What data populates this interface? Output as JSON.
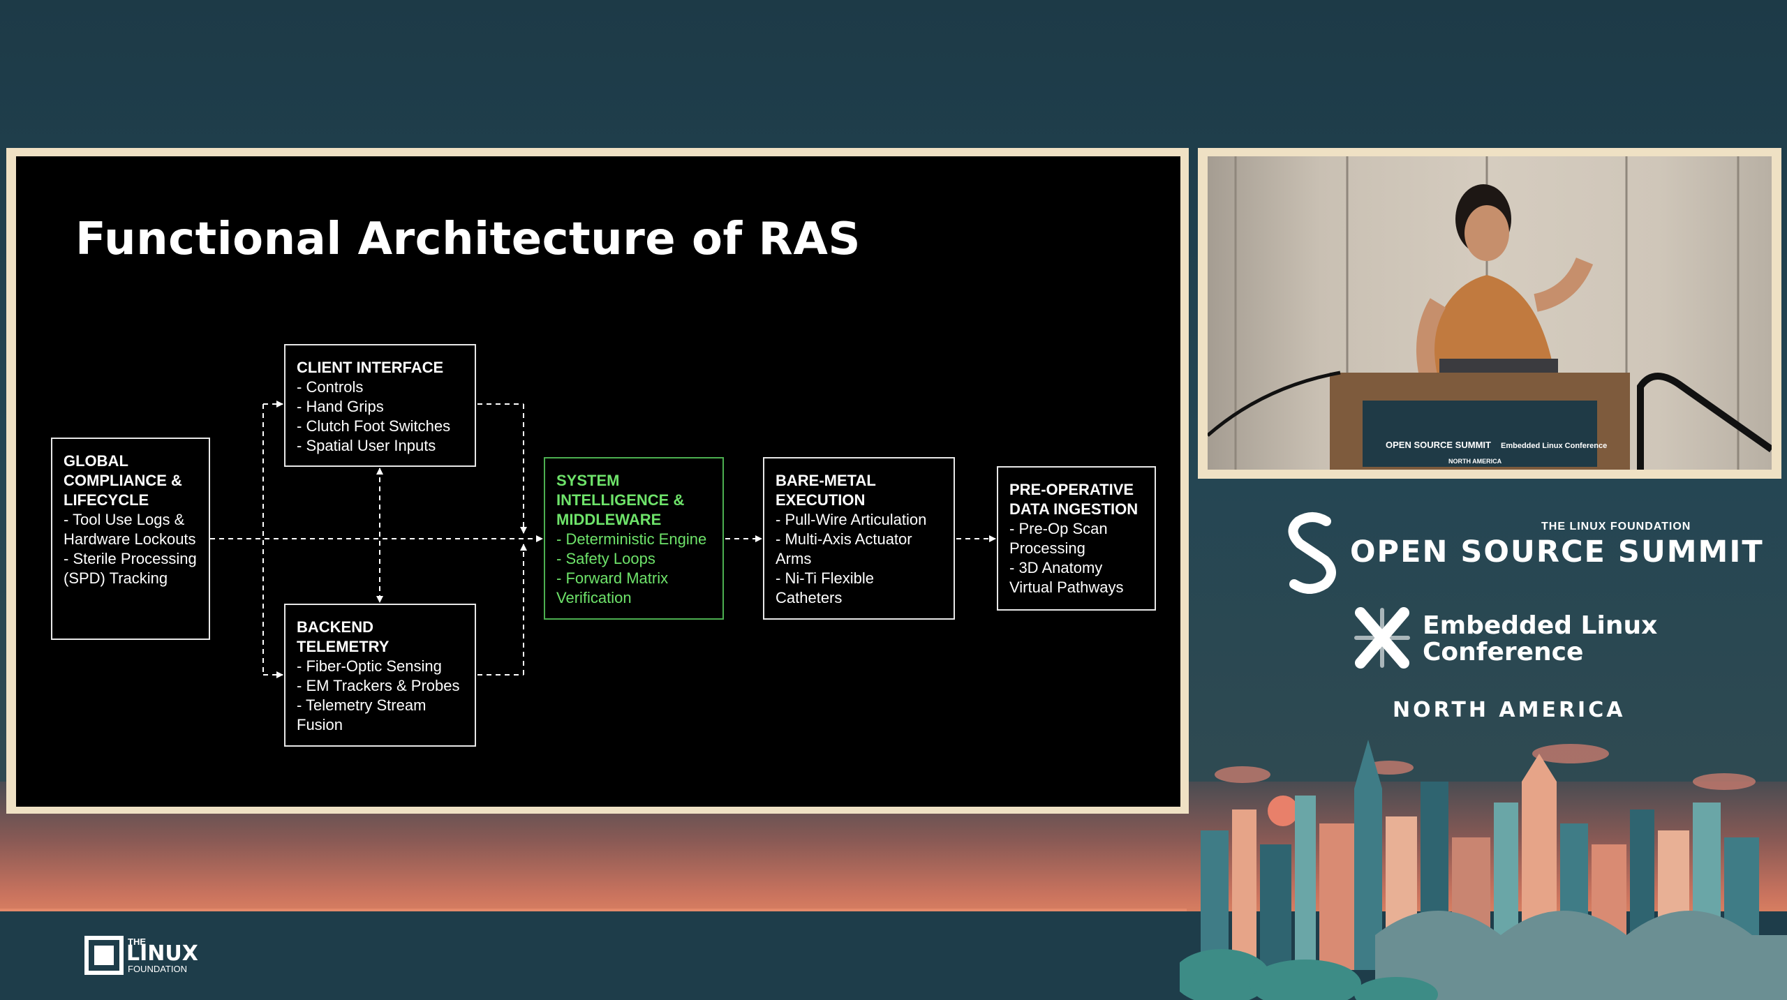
{
  "slide": {
    "title": "Functional Architecture of RAS"
  },
  "diagram": {
    "nodes": [
      {
        "id": "global",
        "title": "GLOBAL COMPLIANCE & LIFECYCLE",
        "items": [
          "- Tool Use Logs & Hardware Lockouts",
          "- Sterile Processing (SPD) Tracking"
        ]
      },
      {
        "id": "client",
        "title": "CLIENT INTERFACE",
        "items": [
          "- Controls",
          "- Hand Grips",
          "- Clutch Foot Switches",
          "- Spatial User Inputs"
        ]
      },
      {
        "id": "backend",
        "title": "BACKEND TELEMETRY",
        "items": [
          "- Fiber-Optic Sensing",
          "- EM Trackers & Probes",
          "- Telemetry Stream Fusion"
        ]
      },
      {
        "id": "system",
        "title": "SYSTEM INTELLIGENCE & MIDDLEWARE",
        "items": [
          "- Deterministic Engine",
          "- Safety Loops",
          "- Forward Matrix Verification"
        ]
      },
      {
        "id": "bare",
        "title": "BARE-METAL EXECUTION",
        "items": [
          "- Pull-Wire Articulation",
          "- Multi-Axis Actuator Arms",
          "- Ni-Ti Flexible Catheters"
        ]
      },
      {
        "id": "preop",
        "title": "PRE-OPERATIVE DATA INGESTION",
        "items": [
          "- Pre-Op Scan Processing",
          "- 3D Anatomy Virtual Pathways"
        ]
      }
    ],
    "edges": [
      {
        "from": "global",
        "to": "client",
        "style": "dashed"
      },
      {
        "from": "global",
        "to": "backend",
        "style": "dashed"
      },
      {
        "from": "global",
        "to": "system",
        "style": "dashed"
      },
      {
        "from": "client",
        "to": "backend",
        "style": "dashed",
        "bidirectional": true
      },
      {
        "from": "client",
        "to": "system",
        "style": "dashed"
      },
      {
        "from": "backend",
        "to": "system",
        "style": "dashed"
      },
      {
        "from": "system",
        "to": "bare",
        "style": "dashed"
      },
      {
        "from": "bare",
        "to": "preop",
        "style": "dashed"
      }
    ],
    "colors": {
      "box_border": "#e8e8e8",
      "accent": "#6ee36a",
      "edge": "#ffffff"
    }
  },
  "camera": {
    "podium_signs": [
      "OPEN SOURCE SUMMIT",
      "Embedded Linux Conference",
      "NORTH AMERICA"
    ]
  },
  "branding": {
    "lf_small": "THE LINUX FOUNDATION",
    "summit": "OPEN SOURCE SUMMIT",
    "elc_line1": "Embedded Linux",
    "elc_line2": "Conference",
    "region": "NORTH AMERICA",
    "footer_logo_the": "THE",
    "footer_logo_linux": "LINUX",
    "footer_logo_foundation": "FOUNDATION"
  },
  "colors": {
    "background": "#1e3d4a",
    "slide_frame": "#efe1c4",
    "sunset": "#d98061"
  }
}
